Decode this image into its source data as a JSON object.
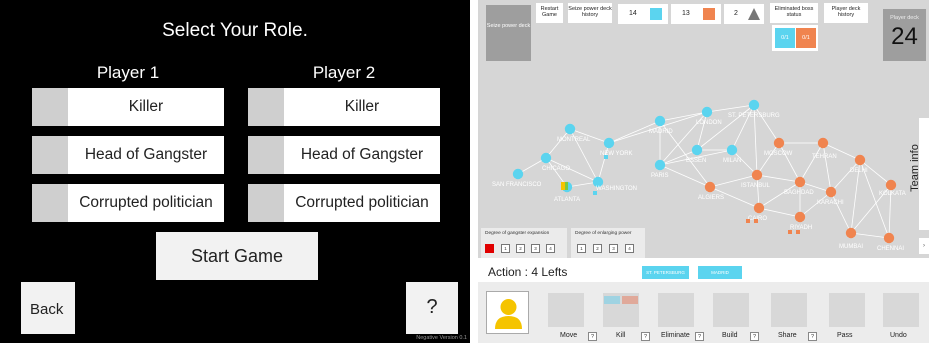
{
  "role_screen": {
    "title": "Select Your Role.",
    "player1_label": "Player 1",
    "player2_label": "Player 2",
    "player1_roles": [
      "Killer",
      "Head of Gangster",
      "Corrupted politician"
    ],
    "player2_roles": [
      "Killer",
      "Head of Gangster",
      "Corrupted politician"
    ],
    "start_label": "Start Game",
    "back_label": "Back",
    "help_label": "?",
    "version_text": "Negative Version 0.1"
  },
  "game": {
    "seize_deck_label": "Seize power deck",
    "restart_label": "Restart Game",
    "seize_history_label": "Seize power deck history",
    "eliminated_label": "Eliminated boss status",
    "player_deck_history_label": "Player deck history",
    "counters": [
      {
        "value": "14",
        "color": "#5bd4ef",
        "icon": "blue-square-icon"
      },
      {
        "value": "13",
        "color": "#f0844f",
        "icon": "orange-square-icon"
      },
      {
        "value": "2",
        "color": "#777777",
        "icon": "triangle-icon"
      }
    ],
    "boss_status": [
      {
        "text": "0/1",
        "color": "#5bd4ef"
      },
      {
        "text": "0/1",
        "color": "#f0844f"
      }
    ],
    "player_deck_label": "Player deck",
    "player_deck_count": "24",
    "team_info_label": "Team info",
    "gangster_expansion_label": "Degree of gangster expansion",
    "gangster_expansion_levels": [
      "1",
      "2",
      "3",
      "4"
    ],
    "enlarging_power_label": "Degree of enlarging power",
    "enlarging_power_levels": [
      "1",
      "2",
      "3",
      "4"
    ],
    "action_label": "Action : 4 Lefts",
    "city_tags": [
      "ST. PETERSBURG",
      "MADRID"
    ],
    "actions": [
      "Move",
      "Kill",
      "Eliminate",
      "Build",
      "Share",
      "Pass",
      "Undo"
    ],
    "action_help": "?",
    "colors": {
      "blue": "#5bd4ef",
      "orange": "#f0844f",
      "yellow": "#f5c400",
      "red": "#e00000"
    },
    "cities": [
      {
        "name": "MONTREAL",
        "color": "blue"
      },
      {
        "name": "CHICAGO",
        "color": "blue"
      },
      {
        "name": "SAN FRANCISCO",
        "color": "blue"
      },
      {
        "name": "NEW YORK",
        "color": "blue"
      },
      {
        "name": "WASHINGTON",
        "color": "blue"
      },
      {
        "name": "ATLANTA",
        "color": "blue"
      },
      {
        "name": "MADRID",
        "color": "blue"
      },
      {
        "name": "LONDON",
        "color": "blue"
      },
      {
        "name": "ST. PETERSBURG",
        "color": "blue"
      },
      {
        "name": "ESSEN",
        "color": "blue"
      },
      {
        "name": "MILAN",
        "color": "blue"
      },
      {
        "name": "PARIS",
        "color": "blue"
      },
      {
        "name": "MOSCOW",
        "color": "orange"
      },
      {
        "name": "TEHRAN",
        "color": "orange"
      },
      {
        "name": "DELHI",
        "color": "orange"
      },
      {
        "name": "ISTANBUL",
        "color": "orange"
      },
      {
        "name": "BAGHDAD",
        "color": "orange"
      },
      {
        "name": "KARACHI",
        "color": "orange"
      },
      {
        "name": "KOLKATA",
        "color": "orange"
      },
      {
        "name": "ALGIERS",
        "color": "orange"
      },
      {
        "name": "CAIRO",
        "color": "orange"
      },
      {
        "name": "RIYADH",
        "color": "orange"
      },
      {
        "name": "MUMBAI",
        "color": "orange"
      },
      {
        "name": "CHENNAI",
        "color": "orange"
      }
    ]
  }
}
